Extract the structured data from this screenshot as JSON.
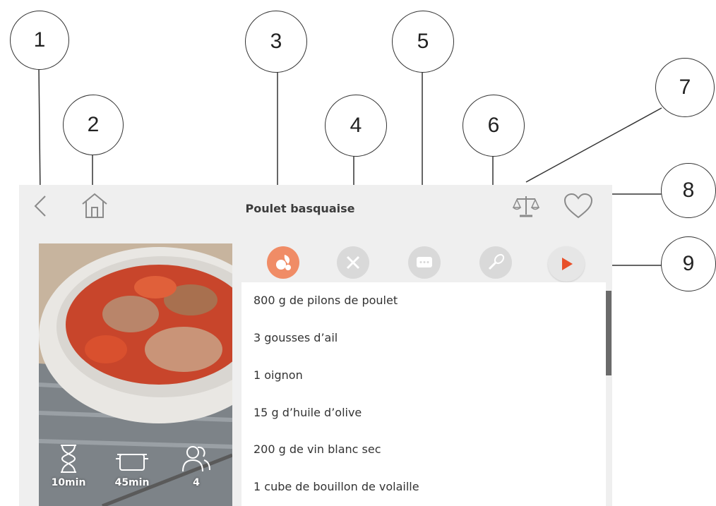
{
  "header": {
    "title": "Poulet basquaise",
    "icons": {
      "back": "chevron-left-icon",
      "home": "home-icon",
      "scale": "scale-icon",
      "favorite": "heart-icon"
    }
  },
  "tabs": [
    {
      "icon": "ingredients-icon",
      "active": true
    },
    {
      "icon": "utensils-icon",
      "active": false
    },
    {
      "icon": "chat-icon",
      "active": false
    },
    {
      "icon": "whisk-icon",
      "active": false
    }
  ],
  "play_icon": "play-icon",
  "recipe_meta": {
    "prep_time": "10min",
    "cook_time": "45min",
    "servings": "4"
  },
  "ingredients": [
    "800 g de pilons de poulet",
    "3 gousses d’ail",
    "1 oignon",
    "15 g d’huile d’olive",
    "200 g de vin blanc sec",
    "1 cube de bouillon de volaille"
  ],
  "callouts": [
    "1",
    "2",
    "3",
    "4",
    "5",
    "6",
    "7",
    "8",
    "9"
  ],
  "colors": {
    "accent": "#f08c66",
    "play": "#e8502a",
    "tab_inactive": "#d9d9d9"
  }
}
